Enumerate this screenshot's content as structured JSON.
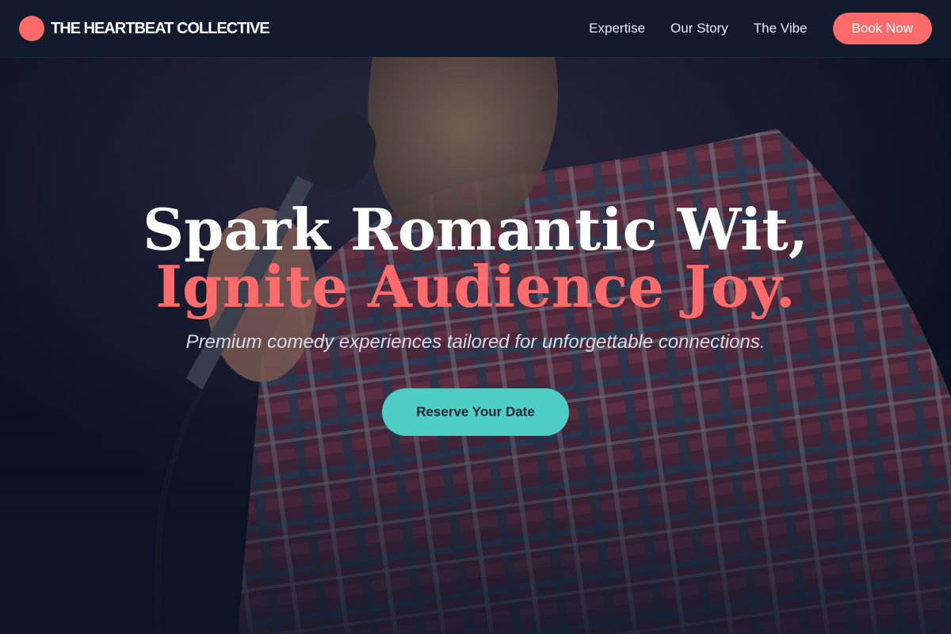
{
  "header": {
    "brand_name": "THE HEARTBEAT COLLECTIVE",
    "nav": [
      {
        "label": "Expertise"
      },
      {
        "label": "Our Story"
      },
      {
        "label": "The Vibe"
      }
    ],
    "book_label": "Book Now"
  },
  "hero": {
    "headline_line1": "Spark Romantic Wit,",
    "headline_line2": "Ignite Audience Joy.",
    "subtitle": "Premium comedy experiences tailored for unforgettable connections.",
    "cta_label": "Reserve Your Date",
    "background_image": "comedian-with-microphone-photo"
  },
  "colors": {
    "accent": "#ff6b6b",
    "secondary": "#4ecdc4",
    "header_bg": "#121a2e",
    "hero_bg": "#0f1628"
  }
}
